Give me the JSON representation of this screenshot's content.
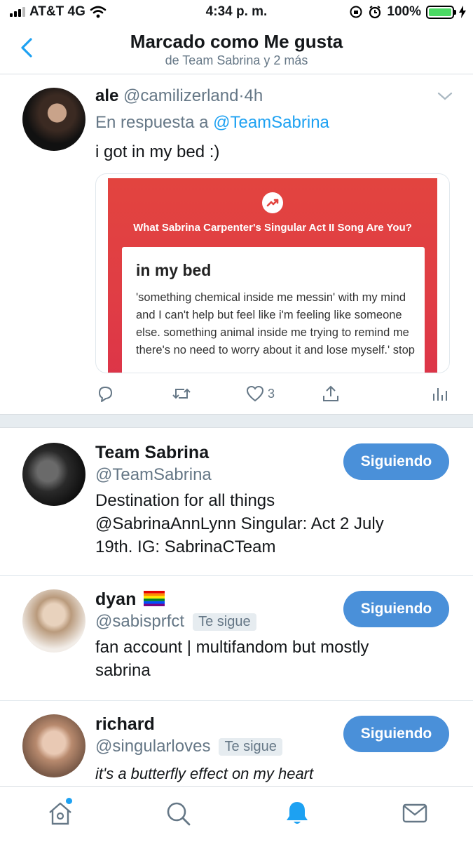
{
  "status_bar": {
    "carrier": "AT&T 4G",
    "time": "4:34 p. m.",
    "battery": "100%",
    "battery_level": 1.0
  },
  "header": {
    "title": "Marcado como Me gusta",
    "subtitle": "de Team Sabrina y 2 más"
  },
  "tweet": {
    "name": "ale",
    "handle": "@camilizerland",
    "separator": "·",
    "time": "4h",
    "reply_prefix": "En respuesta a",
    "reply_handle": "@TeamSabrina",
    "text": "i got in my bed :)",
    "card": {
      "heading": "What Sabrina Carpenter's Singular Act II Song Are You?",
      "result_title": "in my bed",
      "result_text": "'something chemical inside me messin' with my mind and I can't help but feel like i'm feeling like someone else. something animal inside me trying to remind me there's no need to worry about it and lose myself.' stop"
    },
    "like_count": "3"
  },
  "users": [
    {
      "name": "Team Sabrina",
      "handle": "@TeamSabrina",
      "follows_you": "",
      "bio_lines": [
        "Destination for all things",
        "@SabrinaAnnLynn Singular: Act 2 July",
        "19th. IG: SabrinaCTeam"
      ],
      "button": "Siguiendo"
    },
    {
      "name": "dyan",
      "handle": "@sabisprfct",
      "follows_you": "Te sigue",
      "bio_lines": [
        "fan account | multifandom but mostly",
        "sabrina"
      ],
      "button": "Siguiendo"
    },
    {
      "name": "richard",
      "handle": "@singularloves",
      "follows_you": "Te sigue",
      "bio_lines": [
        "it's a butterfly effect on my heart"
      ],
      "button": "Siguiendo"
    }
  ],
  "tabbar": {
    "active": "notifications"
  },
  "colors": {
    "accent": "#1da1f2",
    "follow_button": "#4a90d9",
    "muted_text": "#657786"
  }
}
